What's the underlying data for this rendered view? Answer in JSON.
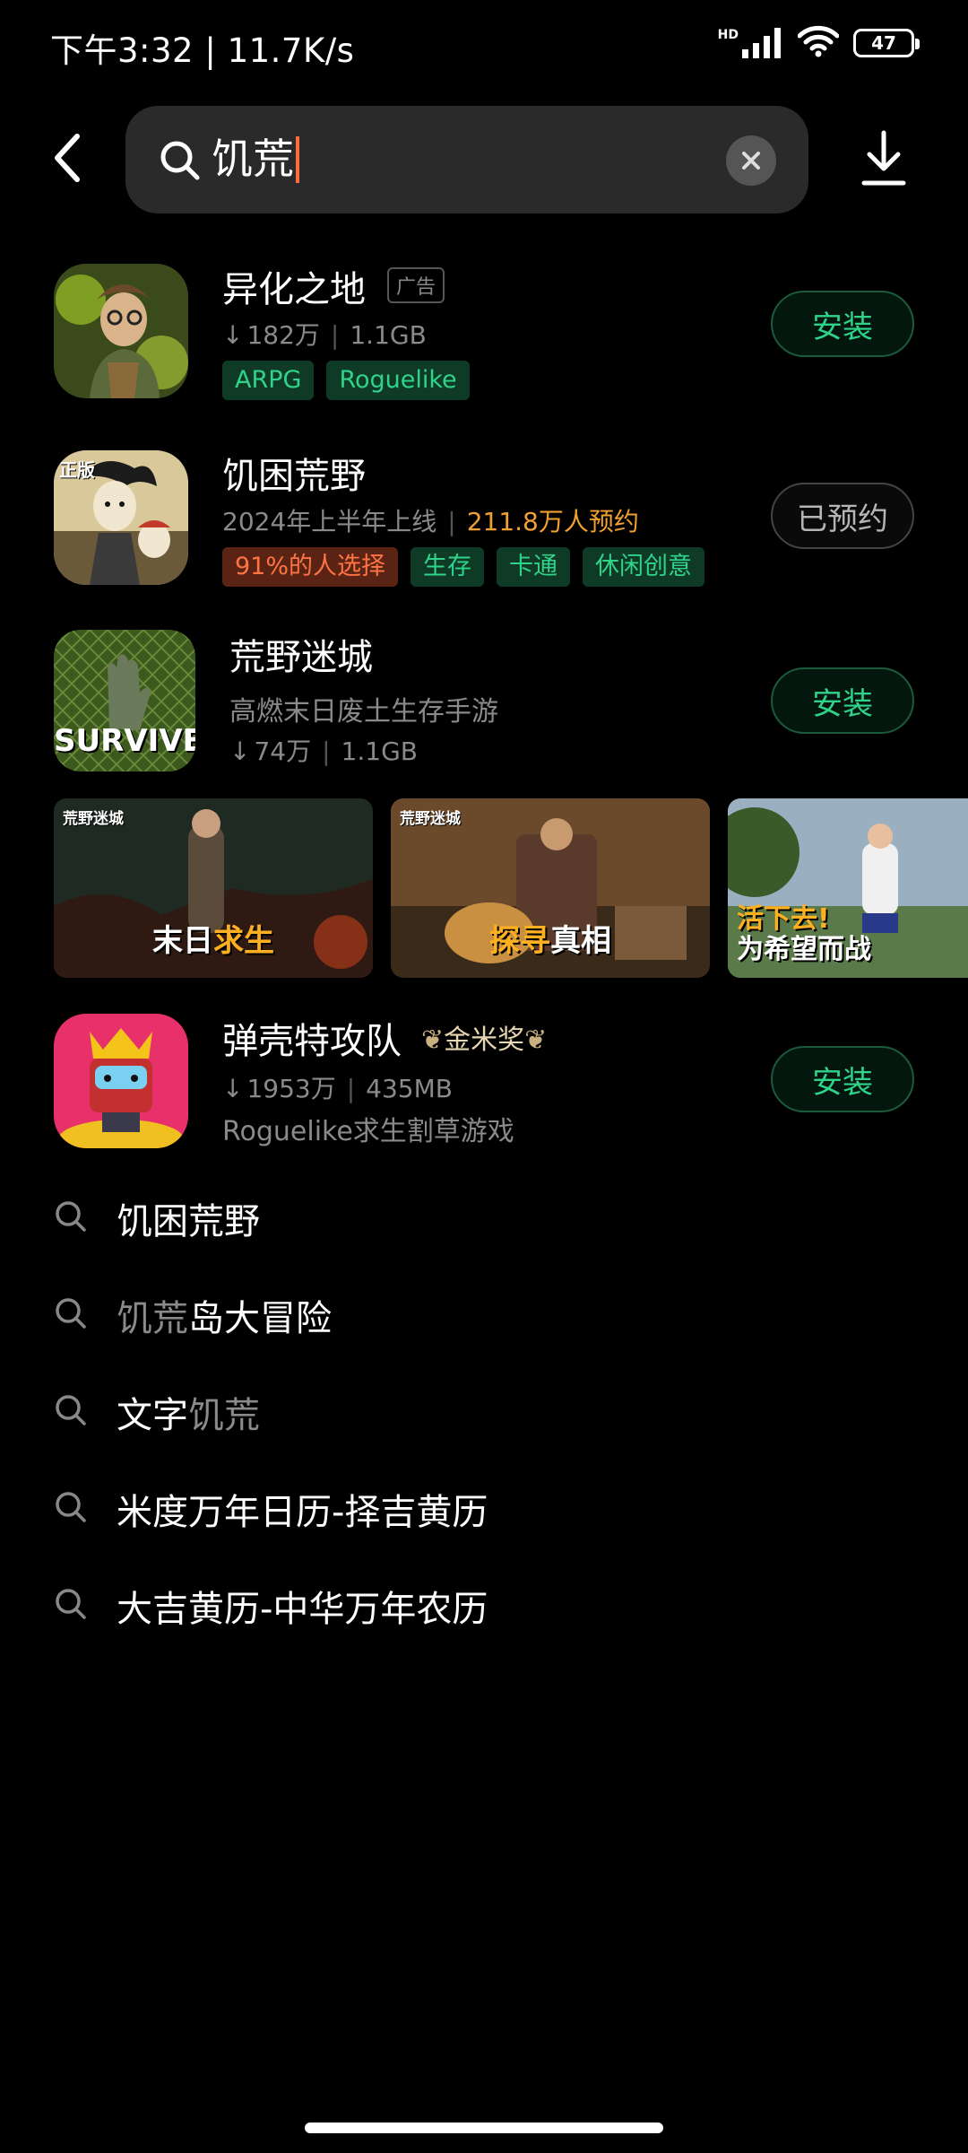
{
  "status_bar": {
    "time_speed": "下午3:32 | 11.7K/s",
    "hd": "HD",
    "battery": "47"
  },
  "search": {
    "value": "饥荒"
  },
  "apps": [
    {
      "name": "异化之地",
      "badge": "广告",
      "downloads": "182万",
      "size": "1.1GB",
      "tags": [
        "ARPG",
        "Roguelike"
      ],
      "action": "安装"
    },
    {
      "name": "饥困荒野",
      "release": "2024年上半年上线",
      "reservations": "211.8万人预约",
      "tags": [
        "91%的人选择",
        "生存",
        "卡通",
        "休闲创意"
      ],
      "action": "已预约",
      "icon_badge": "正版"
    },
    {
      "name": "荒野迷城",
      "desc": "高燃末日废土生存手游",
      "downloads": "74万",
      "size": "1.1GB",
      "action": "安装",
      "icon_text": "SURVIVE"
    },
    {
      "name": "弹壳特攻队",
      "award": "金米奖",
      "downloads": "1953万",
      "size": "435MB",
      "desc": "Roguelike求生割草游戏",
      "action": "安装"
    }
  ],
  "screenshots": [
    {
      "logo": "荒野迷城",
      "caption_a": "末日",
      "caption_b": "求生"
    },
    {
      "logo": "荒野迷城",
      "caption_a": "探寻",
      "caption_b": "真相"
    },
    {
      "caption_a": "活下去!",
      "caption_b": "为希望而战"
    }
  ],
  "suggestions": [
    {
      "match": "饥",
      "rest": "困荒野",
      "match_dim": false
    },
    {
      "match": "饥荒",
      "rest": "岛大冒险",
      "match_dim": true
    },
    {
      "pre": "文字",
      "match": "饥荒",
      "match_dim": true
    },
    {
      "rest": "米度万年日历-择吉黄历"
    },
    {
      "rest": "大吉黄历-中华万年农历"
    }
  ],
  "colors": {
    "accent_green": "#2fd48a",
    "tag_bg": "#0f3a26",
    "warm_orange": "#ff7443",
    "reserve_orange": "#f0a030",
    "background": "#000000"
  }
}
